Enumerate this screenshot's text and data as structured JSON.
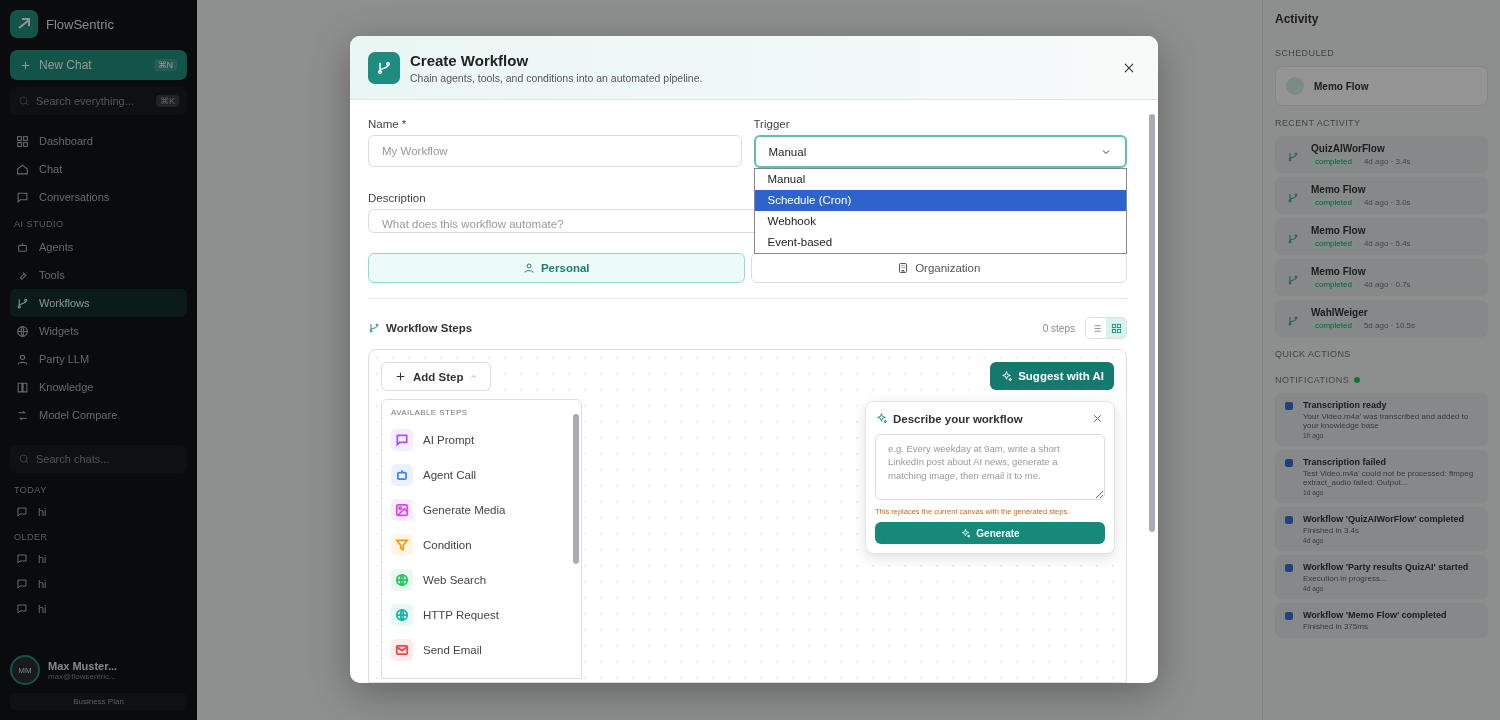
{
  "sidebar": {
    "brand": "FlowSentric",
    "new_chat": {
      "label": "New Chat",
      "shortcut": "⌘N"
    },
    "search": {
      "placeholder": "Search everything...",
      "shortcut": "⌘K"
    },
    "nav_groups": [
      {
        "items": [
          {
            "label": "Dashboard",
            "kind": "grid",
            "selected": false
          },
          {
            "label": "Chat",
            "kind": "home",
            "selected": false
          },
          {
            "label": "Conversations",
            "kind": "bubble",
            "selected": false
          }
        ]
      },
      {
        "heading": "AI STUDIO",
        "items": [
          {
            "label": "Agents",
            "kind": "bot",
            "selected": false
          },
          {
            "label": "Tools",
            "kind": "wrench",
            "selected": false
          },
          {
            "label": "Workflows",
            "kind": "branch",
            "selected": true
          },
          {
            "label": "Widgets",
            "kind": "globe",
            "selected": false
          },
          {
            "label": "Party LLM",
            "kind": "person",
            "selected": false
          },
          {
            "label": "Knowledge",
            "kind": "book",
            "selected": false
          },
          {
            "label": "Model Compare",
            "kind": "compare",
            "selected": false
          }
        ]
      }
    ],
    "chat_search": {
      "placeholder": "Search chats..."
    },
    "chat_groups": [
      {
        "heading": "TODAY",
        "items": [
          "hi"
        ]
      },
      {
        "heading": "OLDER",
        "items": [
          "hi",
          "hi",
          "hi"
        ]
      }
    ],
    "user": {
      "initials": "MM",
      "name": "Max Muster...",
      "email": "max@flowsentric...",
      "plan": "Business Plan"
    }
  },
  "activity": {
    "title": "Activity",
    "scheduled": {
      "heading": "SCHEDULED",
      "items": [
        {
          "name": "Memo Flow"
        }
      ]
    },
    "recent": {
      "heading": "RECENT ACTIVITY",
      "items": [
        {
          "name": "QuizAIWorFlow",
          "status": "completed",
          "meta": "4d ago · 3.4s"
        },
        {
          "name": "Memo Flow",
          "status": "completed",
          "meta": "4d ago · 3.0s"
        },
        {
          "name": "Memo Flow",
          "status": "completed",
          "meta": "4d ago · 5.4s"
        },
        {
          "name": "Memo Flow",
          "status": "completed",
          "meta": "4d ago · 0.7s"
        },
        {
          "name": "WahlWeiger",
          "status": "completed",
          "meta": "5d ago · 10.5s"
        }
      ]
    },
    "quick_actions": {
      "heading": "QUICK ACTIONS"
    },
    "notifications": {
      "heading": "NOTIFICATIONS",
      "unread": true,
      "items": [
        {
          "title": "Transcription ready",
          "body": "Your Video.m4a' was transcribed and added to your knowledge base",
          "time": "1h ago"
        },
        {
          "title": "Transcription failed",
          "body": "Test Video.m4a' could not be processed: ffmpeg extract_audio failed: Output...",
          "time": "1d ago"
        },
        {
          "title": "Workflow 'QuizAIWorFlow' completed",
          "body": "Finished in 3.4s",
          "time": "4d ago"
        },
        {
          "title": "Workflow 'Party results QuizAI' started",
          "body": "Execution in progress...",
          "time": "4d ago"
        },
        {
          "title": "Workflow 'Memo Flow' completed",
          "body": "Finished in 375ms"
        }
      ]
    }
  },
  "dialog": {
    "title": "Create Workflow",
    "subtitle": "Chain agents, tools, and conditions into an automated pipeline.",
    "name": {
      "label": "Name *",
      "placeholder": "My Workflow"
    },
    "trigger": {
      "label": "Trigger",
      "value": "Manual",
      "expanded": true,
      "options": [
        {
          "label": "Manual",
          "highlighted": false
        },
        {
          "label": "Schedule (Cron)",
          "highlighted": true
        },
        {
          "label": "Webhook",
          "highlighted": false
        },
        {
          "label": "Event-based",
          "highlighted": false
        }
      ]
    },
    "description": {
      "label": "Description",
      "placeholder": "What does this workflow automate?"
    },
    "visibility": [
      {
        "label": "Personal",
        "kind": "person",
        "selected": true
      },
      {
        "label": "Organization",
        "kind": "building",
        "selected": false
      }
    ],
    "steps": {
      "heading": "Workflow Steps",
      "count": "0 steps",
      "views": [
        {
          "kind": "list",
          "selected": false
        },
        {
          "kind": "grid",
          "selected": true
        }
      ],
      "add_step": {
        "label": "Add Step",
        "expanded": true
      },
      "palette": {
        "heading": "AVAILABLE STEPS",
        "items": [
          {
            "label": "AI Prompt",
            "kind": "bubble",
            "color": "#a855f7"
          },
          {
            "label": "Agent Call",
            "kind": "bot",
            "color": "#3b82f6"
          },
          {
            "label": "Generate Media",
            "kind": "image",
            "color": "#d946ef"
          },
          {
            "label": "Condition",
            "kind": "funnel",
            "color": "#f59e0b"
          },
          {
            "label": "Web Search",
            "kind": "globe",
            "color": "#22c55e"
          },
          {
            "label": "HTTP Request",
            "kind": "globe",
            "color": "#14b8a6"
          },
          {
            "label": "Send Email",
            "kind": "mail",
            "color": "#ef4444"
          }
        ]
      },
      "suggest": {
        "label": "Suggest with AI"
      },
      "ai_panel": {
        "title": "Describe your workflow",
        "placeholder": "e.g. Every weekday at 9am, write a short LinkedIn post about AI news, generate a matching image, then email it to me.",
        "note": "This replaces the current canvas with the generated steps.",
        "button": "Generate"
      }
    }
  }
}
